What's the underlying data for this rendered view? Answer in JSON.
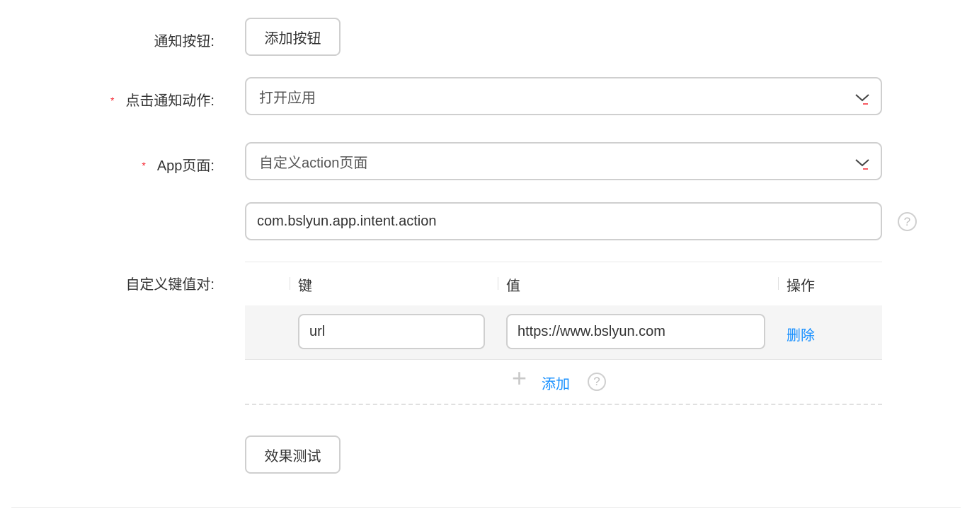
{
  "form": {
    "notify_button": {
      "label": "通知按钮:",
      "button_label": "添加按钮"
    },
    "click_action": {
      "required": "*",
      "label": "点击通知动作:",
      "selected": "打开应用"
    },
    "app_page": {
      "required": "*",
      "label": "App页面:",
      "selected": "自定义action页面"
    },
    "intent_action": {
      "value": "com.bslyun.app.intent.action",
      "help": "?"
    },
    "custom_kv": {
      "label": "自定义键值对:",
      "columns": {
        "key": "键",
        "value": "值",
        "operation": "操作"
      },
      "rows": [
        {
          "key": "url",
          "value": "https://www.bslyun.com",
          "delete_label": "删除"
        }
      ],
      "add_plus": "+",
      "add_label": "添加",
      "help": "?"
    },
    "test_button_label": "效果测试"
  },
  "colors": {
    "link": "#1890ff",
    "required": "#f5222d",
    "border": "#cfcfcf"
  }
}
